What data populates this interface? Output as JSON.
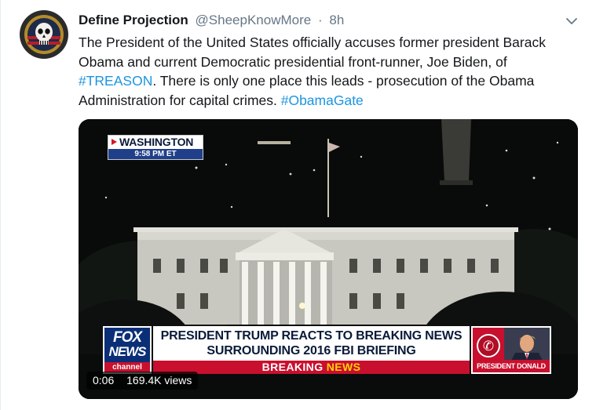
{
  "tweet": {
    "display_name": "Define Projection",
    "handle": "@SheepKnowMore",
    "separator": "·",
    "time": "8h",
    "text_parts": {
      "p1": "The President of the United States officially accuses former president Barack Obama and current Democratic presidential front-runner, Joe Biden, of ",
      "tag1": "#TREASON",
      "p2": ". There is only one place this leads - prosecution of the Obama Administration for capital crimes. ",
      "tag2": "#ObamaGate"
    },
    "icons": {
      "avatar": "skull-avatar",
      "menu": "chevron-down-icon"
    }
  },
  "video": {
    "location": "WASHINGTON",
    "location_time": "9:58 PM ET",
    "channel_logo_line1": "FOX",
    "channel_logo_line2": "NEWS",
    "channel_logo_line3": "channel",
    "headline_line1": "PRESIDENT TRUMP REACTS TO BREAKING NEWS",
    "headline_line2": "SURROUNDING 2016 FBI BRIEFING",
    "breaking_word1": "BREAKING",
    "breaking_word2": "NEWS",
    "caller_label": "PRESIDENT DONALD TRUMP",
    "elapsed": "0:06",
    "views": "169.4K views"
  },
  "colors": {
    "link": "#1b95e0",
    "secondary_text": "#657786",
    "fox_blue": "#0b2f77",
    "fox_red": "#c8102e",
    "breaking_yellow": "#ffd200"
  }
}
